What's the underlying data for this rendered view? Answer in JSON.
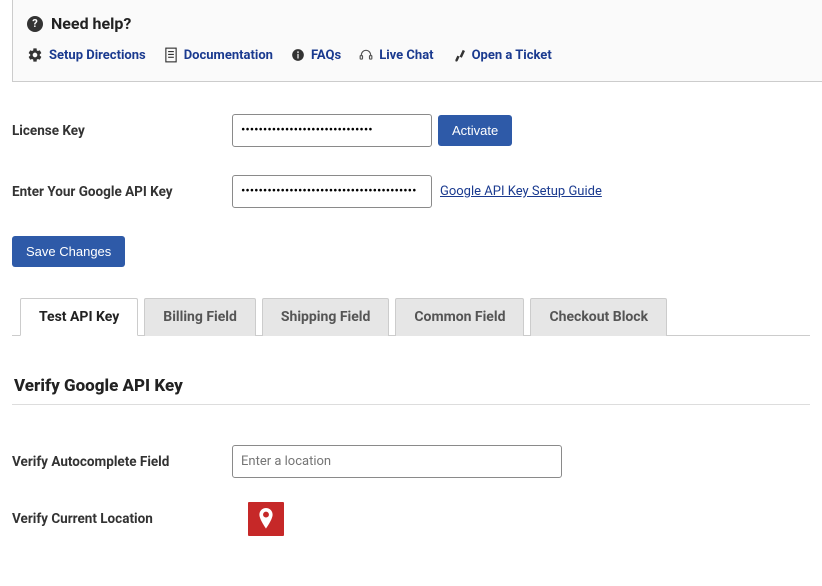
{
  "help": {
    "title": "Need help?",
    "links": {
      "setup": "Setup Directions",
      "docs": "Documentation",
      "faqs": "FAQs",
      "chat": "Live Chat",
      "ticket": "Open a Ticket"
    }
  },
  "form": {
    "license_key_label": "License Key",
    "license_key_value": "••••••••••••••••••••••••••••••",
    "activate_button": "Activate",
    "api_key_label": "Enter Your Google API Key",
    "api_key_value": "••••••••••••••••••••••••••••••••••••••••",
    "api_guide_link": "Google API Key Setup Guide",
    "save_button": "Save Changes"
  },
  "tabs": {
    "test_api": "Test API Key",
    "billing": "Billing Field",
    "shipping": "Shipping Field",
    "common": "Common Field",
    "checkout": "Checkout Block"
  },
  "verify": {
    "section_title": "Verify Google API Key",
    "autocomplete_label": "Verify Autocomplete Field",
    "autocomplete_placeholder": "Enter a location",
    "current_location_label": "Verify Current Location"
  },
  "colors": {
    "primary_button": "#2e5aa8",
    "link": "#1a3a8f",
    "location_button": "#c62828"
  }
}
